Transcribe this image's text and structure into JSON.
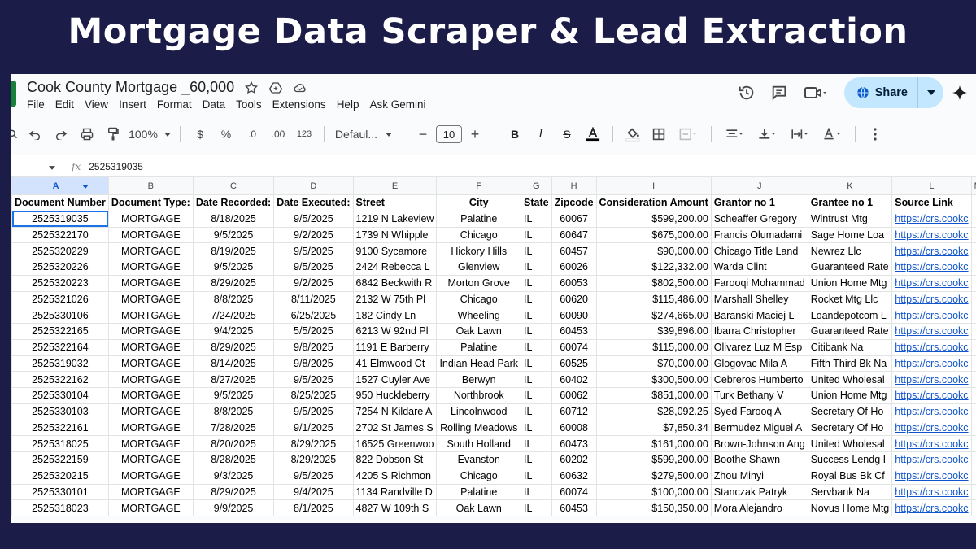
{
  "banner": {
    "title": "Mortgage Data Scraper & Lead Extraction"
  },
  "sheet": {
    "title": "Cook County Mortgage _60,000",
    "menu": [
      "File",
      "Edit",
      "View",
      "Insert",
      "Format",
      "Data",
      "Tools",
      "Extensions",
      "Help",
      "Ask Gemini"
    ],
    "share_label": "Share",
    "accent": "#c2e7ff",
    "brand_color": "#188038"
  },
  "toolbar": {
    "zoom": "100%",
    "currency": "$",
    "percent": "%",
    "dec_less": ".0",
    "dec_more": ".00",
    "number_format": "123",
    "font": "Defaul...",
    "font_size": "10"
  },
  "formula_bar": {
    "content": "2525319035"
  },
  "columns": [
    "A",
    "B",
    "C",
    "D",
    "E",
    "F",
    "G",
    "H",
    "I",
    "J",
    "K",
    "L",
    "M"
  ],
  "headers": [
    "Document Number",
    "Document Type:",
    "Date Recorded:",
    "Date Executed:",
    "Street",
    "City",
    "State",
    "Zipcode",
    "Consideration Amount",
    "Grantor no 1",
    "Grantee no 1",
    "Source Link",
    ""
  ],
  "rows": [
    [
      "2525319035",
      "MORTGAGE",
      "8/18/2025",
      "9/5/2025",
      "1219 N Lakeview",
      "Palatine",
      "IL",
      "60067",
      "$599,200.00",
      "Scheaffer Gregory",
      "Wintrust Mtg",
      "https://crs.cookc"
    ],
    [
      "2525322170",
      "MORTGAGE",
      "9/5/2025",
      "9/2/2025",
      "1739 N Whipple",
      "Chicago",
      "IL",
      "60647",
      "$675,000.00",
      "Francis Olumadami",
      "Sage Home Loa",
      "https://crs.cookc"
    ],
    [
      "2525320229",
      "MORTGAGE",
      "8/19/2025",
      "9/5/2025",
      "9100 Sycamore",
      "Hickory Hills",
      "IL",
      "60457",
      "$90,000.00",
      "Chicago Title Land",
      "Newrez Llc",
      "https://crs.cookc"
    ],
    [
      "2525320226",
      "MORTGAGE",
      "9/5/2025",
      "9/5/2025",
      "2424 Rebecca L",
      "Glenview",
      "IL",
      "60026",
      "$122,332.00",
      "Warda Clint",
      "Guaranteed Rate",
      "https://crs.cookc"
    ],
    [
      "2525320223",
      "MORTGAGE",
      "8/29/2025",
      "9/2/2025",
      "6842 Beckwith R",
      "Morton Grove",
      "IL",
      "60053",
      "$802,500.00",
      "Farooqi Mohammad",
      "Union Home Mtg",
      "https://crs.cookc"
    ],
    [
      "2525321026",
      "MORTGAGE",
      "8/8/2025",
      "8/11/2025",
      "2132 W 75th Pl",
      "Chicago",
      "IL",
      "60620",
      "$115,486.00",
      "Marshall Shelley",
      "Rocket Mtg Llc",
      "https://crs.cookc"
    ],
    [
      "2525330106",
      "MORTGAGE",
      "7/24/2025",
      "6/25/2025",
      "182 Cindy Ln",
      "Wheeling",
      "IL",
      "60090",
      "$274,665.00",
      "Baranski Maciej L",
      "Loandepotcom L",
      "https://crs.cookc"
    ],
    [
      "2525322165",
      "MORTGAGE",
      "9/4/2025",
      "5/5/2025",
      "6213 W 92nd Pl",
      "Oak Lawn",
      "IL",
      "60453",
      "$39,896.00",
      "Ibarra Christopher",
      "Guaranteed Rate",
      "https://crs.cookc"
    ],
    [
      "2525322164",
      "MORTGAGE",
      "8/29/2025",
      "9/8/2025",
      "1191 E Barberry",
      "Palatine",
      "IL",
      "60074",
      "$115,000.00",
      "Olivarez Luz M Esp",
      "Citibank Na",
      "https://crs.cookc"
    ],
    [
      "2525319032",
      "MORTGAGE",
      "8/14/2025",
      "9/8/2025",
      "41 Elmwood Ct",
      "Indian Head Park",
      "IL",
      "60525",
      "$70,000.00",
      "Glogovac Mila A",
      "Fifth Third Bk Na",
      "https://crs.cookc"
    ],
    [
      "2525322162",
      "MORTGAGE",
      "8/27/2025",
      "9/5/2025",
      "1527 Cuyler Ave",
      "Berwyn",
      "IL",
      "60402",
      "$300,500.00",
      "Cebreros Humberto",
      "United Wholesal",
      "https://crs.cookc"
    ],
    [
      "2525330104",
      "MORTGAGE",
      "9/5/2025",
      "8/25/2025",
      "950 Huckleberry",
      "Northbrook",
      "IL",
      "60062",
      "$851,000.00",
      "Turk Bethany V",
      "Union Home Mtg",
      "https://crs.cookc"
    ],
    [
      "2525330103",
      "MORTGAGE",
      "8/8/2025",
      "9/5/2025",
      "7254 N Kildare A",
      "Lincolnwood",
      "IL",
      "60712",
      "$28,092.25",
      "Syed Farooq A",
      "Secretary Of Ho",
      "https://crs.cookc"
    ],
    [
      "2525322161",
      "MORTGAGE",
      "7/28/2025",
      "9/1/2025",
      "2702 St James S",
      "Rolling Meadows",
      "IL",
      "60008",
      "$7,850.34",
      "Bermudez Miguel A",
      "Secretary Of Ho",
      "https://crs.cookc"
    ],
    [
      "2525318025",
      "MORTGAGE",
      "8/20/2025",
      "8/29/2025",
      "16525 Greenwoo",
      "South Holland",
      "IL",
      "60473",
      "$161,000.00",
      "Brown-Johnson Ang",
      "United Wholesal",
      "https://crs.cookc"
    ],
    [
      "2525322159",
      "MORTGAGE",
      "8/28/2025",
      "8/29/2025",
      "822 Dobson St",
      "Evanston",
      "IL",
      "60202",
      "$599,200.00",
      "Boothe Shawn",
      "Success Lendg I",
      "https://crs.cookc"
    ],
    [
      "2525320215",
      "MORTGAGE",
      "9/3/2025",
      "9/5/2025",
      "4205 S Richmon",
      "Chicago",
      "IL",
      "60632",
      "$279,500.00",
      "Zhou Minyi",
      "Royal Bus Bk Cf",
      "https://crs.cookc"
    ],
    [
      "2525330101",
      "MORTGAGE",
      "8/29/2025",
      "9/4/2025",
      "1134 Randville D",
      "Palatine",
      "IL",
      "60074",
      "$100,000.00",
      "Stanczak Patryk",
      "Servbank Na",
      "https://crs.cookc"
    ],
    [
      "2525318023",
      "MORTGAGE",
      "9/9/2025",
      "8/1/2025",
      "4827 W 109th S",
      "Oak Lawn",
      "IL",
      "60453",
      "$150,350.00",
      "Mora Alejandro",
      "Novus Home Mtg",
      "https://crs.cookc"
    ]
  ]
}
